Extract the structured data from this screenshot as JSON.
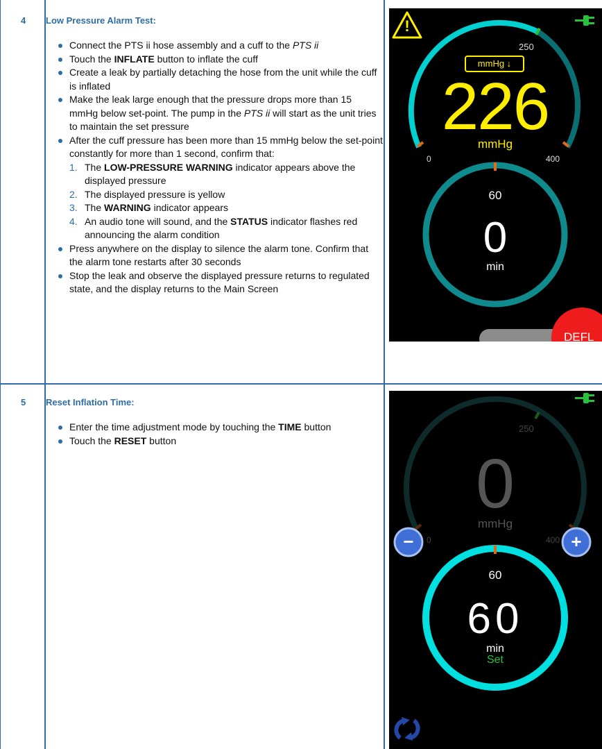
{
  "step4": {
    "number": "4",
    "title": "Low Pressure Alarm Test:",
    "bullets": [
      [
        "Connect the PTS ii hose assembly and a cuff to the ",
        {
          "i": "PTS ii"
        }
      ],
      [
        "Touch the ",
        {
          "b": "INFLATE"
        },
        " button to inflate the cuff"
      ],
      [
        "Create a leak by partially detaching the hose from the unit while the cuff is inflated"
      ],
      [
        "Make the leak large enough that the pressure drops more than 15 mmHg below set-point.  The pump in the ",
        {
          "i": "PTS ii"
        },
        " will start as the unit tries to maintain the set pressure"
      ],
      [
        "After the cuff pressure has been more than 15 mmHg below the set-point constantly for more than 1 second, confirm that:"
      ],
      [
        "Press anywhere on the display to silence the alarm tone. Confirm that the alarm tone restarts after 30 seconds"
      ],
      [
        "Stop the leak and observe the displayed pressure returns to regulated state, and the display returns to the Main Screen"
      ]
    ],
    "sublist": [
      {
        "n": "1.",
        "parts": [
          "The ",
          {
            "b": "LOW-PRESSURE WARNING"
          },
          " indicator appears above the displayed pressure"
        ]
      },
      {
        "n": "2.",
        "parts": [
          "The displayed pressure is yellow"
        ]
      },
      {
        "n": "3.",
        "parts": [
          "The ",
          {
            "b": "WARNING"
          },
          " indicator appears"
        ]
      },
      {
        "n": "4.",
        "parts": [
          "An audio tone will sound, and the ",
          {
            "b": "STATUS"
          },
          " indicator flashes red announcing the alarm condition"
        ]
      }
    ]
  },
  "step5": {
    "number": "5",
    "title": "Reset Inflation Time:",
    "bullets": [
      [
        "Enter the time adjustment mode by touching the ",
        {
          "b": "TIME"
        },
        " button"
      ],
      [
        "Touch the ",
        {
          "b": "RESET"
        },
        " button"
      ]
    ]
  },
  "screen1": {
    "warning_symbol": "!",
    "unit_badge": "mmHg ↓",
    "pressure": "226",
    "pressure_unit": "mmHg",
    "scale_max": "250",
    "scale_zero": "0",
    "scale_400": "400",
    "time_set": "60",
    "time_value": "0",
    "time_unit": "min",
    "defl_button": "DEFL",
    "colors": {
      "arc": "#00d0d0",
      "arc_dim": "#0a6f72",
      "warn": "#ffee00",
      "defl": "#ee1c1c",
      "tick": "#e06a1a"
    }
  },
  "screen2": {
    "scale_max": "250",
    "pressure": "0",
    "pressure_unit": "mmHg",
    "scale_zero": "0",
    "scale_400": "400",
    "time_set": "60",
    "time_value": "60",
    "time_unit": "min",
    "time_status": "Set",
    "minus_label": "−",
    "plus_label": "+",
    "colors": {
      "arc": "#00e0e0",
      "dim_arc": "#0f2a2a",
      "set": "#27c23a",
      "btn": "#3f6fd6"
    }
  }
}
